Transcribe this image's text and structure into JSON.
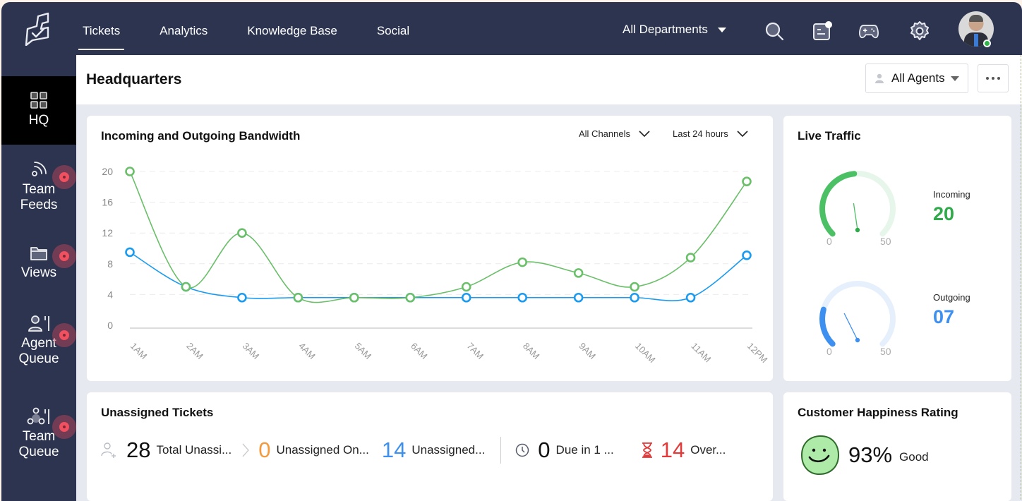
{
  "topbar": {
    "nav": [
      {
        "label": "Tickets",
        "active": true
      },
      {
        "label": "Analytics",
        "active": false
      },
      {
        "label": "Knowledge Base",
        "active": false
      },
      {
        "label": "Social",
        "active": false
      }
    ],
    "department": "All Departments",
    "icons": [
      "search-icon",
      "notifications-icon",
      "gamepad-icon",
      "settings-icon"
    ],
    "user_status": "online"
  },
  "sidebar": {
    "items": [
      {
        "label": "HQ",
        "icon": "grid-icon",
        "active": true,
        "badge": false
      },
      {
        "label": "Team\nFeeds",
        "line1": "Team",
        "line2": "Feeds",
        "icon": "feed-icon",
        "badge": true
      },
      {
        "label": "Views",
        "icon": "folder-icon",
        "badge": true
      },
      {
        "label": "Agent Queue",
        "line1": "Agent",
        "line2": "Queue",
        "icon": "agent-queue-icon",
        "badge": true
      },
      {
        "label": "Team Queue",
        "line1": "Team",
        "line2": "Queue",
        "icon": "team-queue-icon",
        "badge": true
      }
    ]
  },
  "header": {
    "title": "Headquarters",
    "agents_filter": "All Agents",
    "more_label": "More options"
  },
  "bandwidth": {
    "title": "Incoming and Outgoing Bandwidth",
    "channel_filter": "All Channels",
    "time_filter": "Last 24 hours"
  },
  "chart_data": {
    "type": "line",
    "title": "Incoming and Outgoing Bandwidth",
    "xlabel": "",
    "ylabel": "",
    "categories": [
      "1AM",
      "2AM",
      "3AM",
      "4AM",
      "5AM",
      "6AM",
      "7AM",
      "8AM",
      "9AM",
      "10AM",
      "11AM",
      "12PM"
    ],
    "yticks": [
      0,
      4,
      8,
      12,
      16,
      20
    ],
    "ylim": [
      0,
      20
    ],
    "grid": true,
    "legend": "none",
    "series": [
      {
        "name": "Incoming",
        "color": "#6abf69",
        "smooth": true,
        "values": [
          20,
          5,
          12,
          3.6,
          3.6,
          3.6,
          5,
          8.2,
          6.8,
          5,
          8.8,
          18.7
        ]
      },
      {
        "name": "Outgoing",
        "color": "#1a9bef",
        "smooth": true,
        "values": [
          9.5,
          5,
          3.6,
          3.6,
          3.6,
          3.6,
          3.6,
          3.6,
          3.6,
          3.6,
          3.6,
          9.1
        ]
      }
    ]
  },
  "live_traffic": {
    "title": "Live Traffic",
    "gauges": [
      {
        "label": "Incoming",
        "value": 20,
        "display": "20",
        "min": "0",
        "max": "50",
        "color": "#4cc065",
        "track": "#e7f6ea",
        "value_color": "#2eaa4a"
      },
      {
        "label": "Outgoing",
        "value": 7,
        "display": "07",
        "min": "0",
        "max": "50",
        "color": "#3d8ff0",
        "track": "#e6f0fc",
        "value_color": "#3d8ff0"
      }
    ]
  },
  "unassigned": {
    "title": "Unassigned Tickets",
    "stats": [
      {
        "icon": "add-user-icon",
        "value": "28",
        "label": "Total Unassi...",
        "color": "#111111"
      },
      {
        "icon": "chevron-right-icon",
        "value": "0",
        "label": "Unassigned On...",
        "color": "#f39a3b"
      },
      {
        "icon": "",
        "value": "14",
        "label": "Unassigned...",
        "color": "#3d8ff0"
      },
      {
        "icon": "clock-icon",
        "value": "0",
        "label": "Due in 1 ...",
        "color": "#111111"
      },
      {
        "icon": "hourglass-icon",
        "value": "14",
        "label": "Over...",
        "color": "#e03a3a"
      }
    ]
  },
  "happiness": {
    "title": "Customer Happiness Rating",
    "percent": "93%",
    "rating": "Good",
    "face_color": "#aeeaa8"
  }
}
